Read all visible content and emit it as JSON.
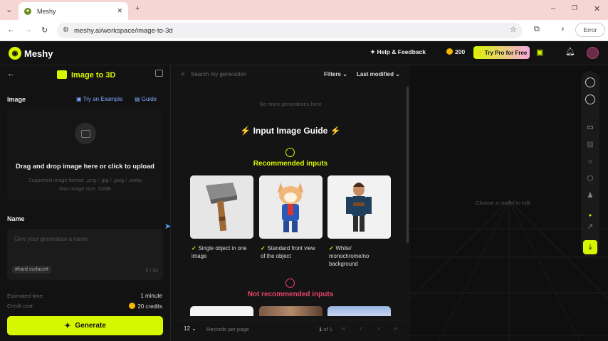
{
  "browser": {
    "tab_title": "Meshy",
    "url": "meshy.ai/workspace/image-to-3d",
    "error_label": "Error"
  },
  "header": {
    "logo": "Meshy",
    "help": "Help & Feedback",
    "credits": "200",
    "try_pro": "Try Pro for Free"
  },
  "left": {
    "title": "Image to 3D",
    "image_label": "Image",
    "try_example": "Try an Example",
    "guide": "Guide",
    "drop_main": "Drag and drop image here or click to upload",
    "drop_formats": "Supported image format: .png / .jpg / .jpeg / .webp",
    "drop_size": "Max image size: 20MB",
    "name_label": "Name",
    "name_placeholder": "Give your generation a name",
    "name_tag": "#hard surface#",
    "name_count": "0 / 50",
    "est_label": "Estimated time:",
    "est_value": "1 minute",
    "cost_label": "Credit cost:",
    "cost_value": "20 credits",
    "generate": "Generate"
  },
  "middle": {
    "search_placeholder": "Search my generation",
    "filters": "Filters",
    "last_modified": "Last modified",
    "no_more": "No more generations here",
    "guide_title": "Input Image Guide",
    "recommended_title": "Recommended inputs",
    "recommended": [
      {
        "caption": "Single object in one image"
      },
      {
        "caption": "Standard front view of the object"
      },
      {
        "caption": "White/ monochrome/no background"
      }
    ],
    "not_recommended_title": "Not recommended inputs",
    "per_page": "12",
    "per_page_label": "Records per page",
    "page_current": "1",
    "page_info": "of 1"
  },
  "viewport": {
    "placeholder": "Choose a model to edit"
  },
  "colors": {
    "accent": "#d6f700",
    "danger": "#e8456a",
    "link": "#7fa8ff",
    "bg": "#141414"
  }
}
